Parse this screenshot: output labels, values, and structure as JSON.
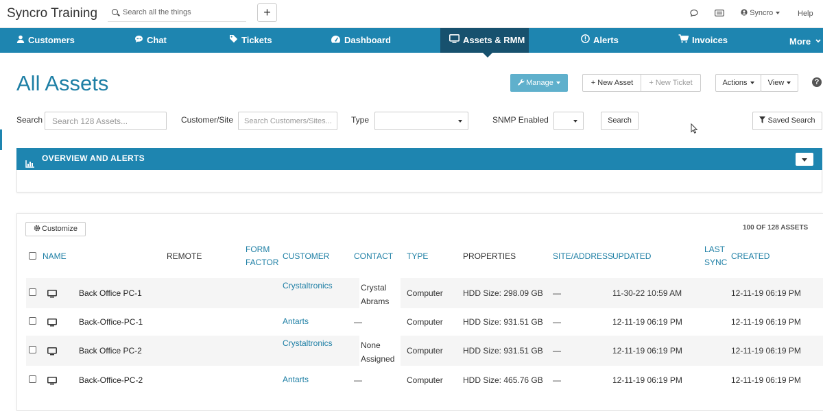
{
  "app": {
    "title": "Syncro Training"
  },
  "topbar": {
    "search_placeholder": "Search all the things",
    "add_label": "+",
    "user_label": "Syncro",
    "help_label": "Help"
  },
  "nav": {
    "items": [
      {
        "label": "Customers",
        "icon": "user-icon"
      },
      {
        "label": "Chat",
        "icon": "chat-bubble-icon"
      },
      {
        "label": "Tickets",
        "icon": "tag-icon"
      },
      {
        "label": "Dashboard",
        "icon": "gauge-icon"
      },
      {
        "label": "Assets & RMM",
        "icon": "monitor-icon",
        "active": true
      },
      {
        "label": "Alerts",
        "icon": "alert-circle-icon"
      },
      {
        "label": "Invoices",
        "icon": "cart-icon"
      },
      {
        "label": "More",
        "icon": "chevron-down-icon"
      }
    ]
  },
  "page": {
    "title": "All Assets",
    "manage_label": "Manage",
    "new_asset_label": "+ New Asset",
    "new_ticket_label": "+ New Ticket",
    "actions_label": "Actions",
    "view_label": "View",
    "help_icon": "?"
  },
  "filters": {
    "search_label": "Search",
    "search_placeholder": "Search 128 Assets...",
    "customer_label": "Customer/Site",
    "customer_placeholder": "Search Customers/Sites...",
    "type_label": "Type",
    "type_value": "",
    "snmp_label": "SNMP Enabled",
    "snmp_value": "",
    "search_button": "Search",
    "saved_search_button": "Saved Search"
  },
  "overview": {
    "title": "OVERVIEW AND ALERTS"
  },
  "table": {
    "customize_label": "Customize",
    "count_label": "100 OF 128 ASSETS",
    "columns": {
      "name": "NAME",
      "remote": "REMOTE",
      "form_factor_1": "FORM",
      "form_factor_2": "FACTOR",
      "customer": "CUSTOMER",
      "contact": "CONTACT",
      "type": "TYPE",
      "properties": "PROPERTIES",
      "site": "SITE/ADDRESS",
      "updated": "UPDATED",
      "last_sync_1": "LAST",
      "last_sync_2": "SYNC",
      "created": "CREATED"
    },
    "rows": [
      {
        "name": "Back Office PC-1",
        "customer": "Crystaltronics",
        "contact_1": "Crystal",
        "contact_2": "Abrams",
        "type": "Computer",
        "properties": "HDD Size: 298.09 GB",
        "site": "—",
        "updated": "11-30-22 10:59 AM",
        "created": "12-11-19 06:19 PM"
      },
      {
        "name": "Back-Office-PC-1",
        "customer": "Antarts",
        "contact_1": "—",
        "contact_2": "",
        "type": "Computer",
        "properties": "HDD Size: 931.51 GB",
        "site": "—",
        "updated": "12-11-19 06:19 PM",
        "created": "12-11-19 06:19 PM"
      },
      {
        "name": "Back Office PC-2",
        "customer": "Crystaltronics",
        "contact_1": "None",
        "contact_2": "Assigned",
        "type": "Computer",
        "properties": "HDD Size: 931.51 GB",
        "site": "—",
        "updated": "12-11-19 06:19 PM",
        "created": "12-11-19 06:19 PM"
      },
      {
        "name": "Back-Office-PC-2",
        "customer": "Antarts",
        "contact_1": "—",
        "contact_2": "",
        "type": "Computer",
        "properties": "HDD Size: 465.76 GB",
        "site": "—",
        "updated": "12-11-19 06:19 PM",
        "created": "12-11-19 06:19 PM"
      }
    ]
  },
  "colors": {
    "nav_bg": "#1e85b0",
    "nav_active": "#17516e",
    "accent": "#1e7fa5",
    "manage_btn": "#5fb0cc"
  }
}
